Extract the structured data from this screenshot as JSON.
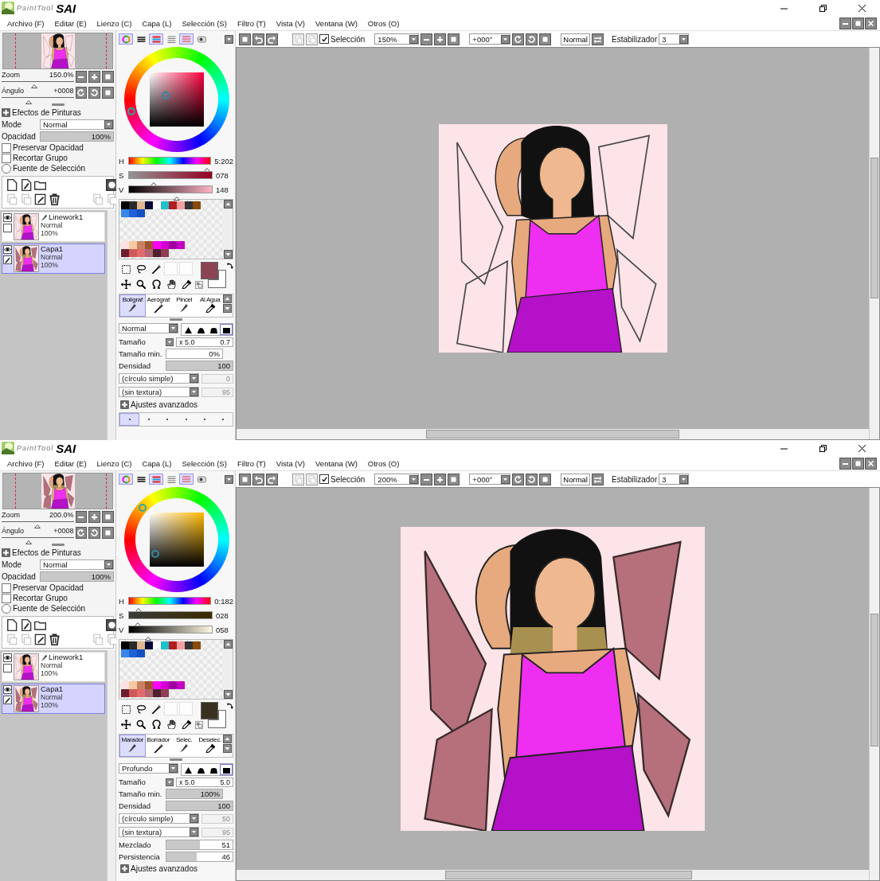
{
  "windows": [
    {
      "logo": {
        "prefix": "PaintTool",
        "name": "SAI"
      },
      "menu": [
        "Archivo (F)",
        "Editar (E)",
        "Lienzo (C)",
        "Capa (L)",
        "Selección (S)",
        "Filtro (T)",
        "Vista (V)",
        "Ventana (W)",
        "Otros (O)"
      ],
      "zoom": {
        "label": "Zoom",
        "value": "150.0%",
        "level": 0.45
      },
      "angle": {
        "label": "Ángulo",
        "value": "+0008",
        "level": 0.38
      },
      "effects": "Efectos de Pinturas",
      "mode": {
        "label": "Mode",
        "value": "Normal"
      },
      "opacity": {
        "label": "Opacidad",
        "value": "100%",
        "level": 1
      },
      "options": [
        {
          "kind": "checkbox",
          "label": "Preservar Opacidad",
          "checked": false
        },
        {
          "kind": "checkbox",
          "label": "Recortar Grupo",
          "checked": false
        },
        {
          "kind": "radio",
          "label": "Fuente de Selección",
          "checked": false
        }
      ],
      "layers": [
        {
          "name": "Linework1",
          "mode": "Normal",
          "opacity": "100%",
          "selected": false
        },
        {
          "name": "Capa1",
          "mode": "Normal",
          "opacity": "100%",
          "selected": true
        }
      ],
      "color_tabs": [
        {
          "selected": true
        },
        {
          "selected": false
        },
        {
          "selected": true
        },
        {
          "selected": false
        },
        {
          "selected": true
        },
        {
          "selected": false
        }
      ],
      "hsv": [
        {
          "label": "H",
          "value": "5:202",
          "level": 0.96
        },
        {
          "label": "S",
          "value": "078",
          "level": 0.3
        },
        {
          "label": "V",
          "value": "148",
          "level": 0.58
        }
      ],
      "palette_upper": [
        [
          {
            "color": "#000000"
          },
          {
            "color": "#2a2a2a"
          },
          {
            "color": "#e2b690"
          },
          {
            "color": "#080838"
          },
          {
            "color": "#ffffff"
          },
          {
            "color": "#1fc0cc"
          },
          {
            "color": "#b01e1e"
          },
          {
            "color": "#f5a0a0"
          },
          {
            "color": "#333333"
          },
          {
            "color": "#8a4a0a"
          }
        ],
        [
          {
            "color": "#3a86e6"
          },
          {
            "color": "#2060d8"
          },
          {
            "color": "#1450c0"
          }
        ]
      ],
      "palette_lower": [
        [
          {
            "color": "#fde2e2"
          },
          {
            "color": "#f8c8a0"
          },
          {
            "color": "#c88262"
          },
          {
            "color": "#a05232"
          },
          {
            "color": "#ff00ff"
          },
          {
            "color": "#d400d4"
          },
          {
            "color": "#a000a0"
          },
          {
            "color": "#c400c4"
          }
        ],
        [
          {
            "color": "#6e1e2a"
          },
          {
            "color": "#d05a5a"
          },
          {
            "color": "#e06c6c"
          },
          {
            "color": "#b46470"
          },
          {
            "color": "#4e2030"
          },
          {
            "color": "#8e4050"
          }
        ]
      ],
      "current_color": {
        "color": "#8b4452"
      },
      "brushes": [
        {
          "label": "Bolígraf",
          "selected": true
        },
        {
          "label": "Aerógraf",
          "selected": false
        },
        {
          "label": "Pincel",
          "selected": false
        },
        {
          "label": "Al Agua",
          "selected": false
        }
      ],
      "blend": "Normal",
      "tip_shapes": [
        {
          "selected": false
        },
        {
          "selected": false
        },
        {
          "selected": false
        },
        {
          "selected": true
        }
      ],
      "size": {
        "label": "Tamaño",
        "multiplier": "x 5.0",
        "value": "0.7"
      },
      "min_size": {
        "label": "Tamaño min.",
        "value": "0%",
        "level": 0
      },
      "density": {
        "label": "Densidad",
        "value": "100",
        "level": 1
      },
      "shape": {
        "value": "(círculo simple)",
        "field": "0",
        "disabled": true
      },
      "texture": {
        "value": "(sin textura)",
        "field": "95",
        "disabled": true
      },
      "advanced": "Ajustes avanzados",
      "brush_dots": [
        {
          "selected": true
        },
        {
          "selected": false
        },
        {
          "selected": false
        },
        {
          "selected": false
        },
        {
          "selected": false
        },
        {
          "selected": false
        }
      ],
      "toolbar": {
        "selection": {
          "label": "Selección",
          "checked": true
        },
        "zoom": "150%",
        "angle": "+000°",
        "mode": "Normal",
        "stabilizer": {
          "label": "Estabilizador",
          "value": "3"
        }
      },
      "canvas": {
        "kind": "picture"
      }
    },
    {
      "logo": {
        "prefix": "PaintTool",
        "name": "SAI"
      },
      "menu": [
        "Archivo (F)",
        "Editar (E)",
        "Lienzo (C)",
        "Capa (L)",
        "Selección (S)",
        "Filtro (T)",
        "Vista (V)",
        "Ventana (W)",
        "Otros (O)"
      ],
      "zoom": {
        "label": "Zoom",
        "value": "200.0%",
        "level": 0.5
      },
      "angle": {
        "label": "Ángulo",
        "value": "+0008",
        "level": 0.38
      },
      "effects": "Efectos de Pinturas",
      "mode": {
        "label": "Mode",
        "value": "Normal"
      },
      "opacity": {
        "label": "Opacidad",
        "value": "100%",
        "level": 1
      },
      "options": [
        {
          "kind": "checkbox",
          "label": "Preservar Opacidad",
          "checked": false
        },
        {
          "kind": "checkbox",
          "label": "Recortar Grupo",
          "checked": false
        },
        {
          "kind": "radio",
          "label": "Fuente de Selección",
          "checked": false
        }
      ],
      "layers": [
        {
          "name": "Linework1",
          "mode": "Normal",
          "opacity": "100%",
          "selected": false
        },
        {
          "name": "Capa1",
          "mode": "Normal",
          "opacity": "100%",
          "selected": true
        }
      ],
      "color_tabs": [
        {
          "selected": true
        },
        {
          "selected": false
        },
        {
          "selected": true
        },
        {
          "selected": false
        },
        {
          "selected": true
        },
        {
          "selected": false
        }
      ],
      "hsv": [
        {
          "label": "H",
          "value": "0:182",
          "level": 0.12
        },
        {
          "label": "S",
          "value": "028",
          "level": 0.11
        },
        {
          "label": "V",
          "value": "058",
          "level": 0.23
        }
      ],
      "palette_upper": [
        [
          {
            "color": "#000000"
          },
          {
            "color": "#2a2a2a"
          },
          {
            "color": "#e2b690"
          },
          {
            "color": "#080838"
          },
          {
            "color": "#ffffff"
          },
          {
            "color": "#1fc0cc"
          },
          {
            "color": "#b01e1e"
          },
          {
            "color": "#f5a0a0"
          },
          {
            "color": "#333333"
          },
          {
            "color": "#8a4a0a"
          }
        ],
        [
          {
            "color": "#3a86e6"
          },
          {
            "color": "#2060d8"
          },
          {
            "color": "#1450c0"
          }
        ]
      ],
      "palette_lower": [
        [
          {
            "color": "#fde2e2"
          },
          {
            "color": "#f8c8a0"
          },
          {
            "color": "#c88262"
          },
          {
            "color": "#a05232"
          },
          {
            "color": "#ff00ff"
          },
          {
            "color": "#d400d4"
          },
          {
            "color": "#a000a0"
          },
          {
            "color": "#c400c4"
          }
        ],
        [
          {
            "color": "#6e1e2a"
          },
          {
            "color": "#d05a5a"
          },
          {
            "color": "#e06c6c"
          },
          {
            "color": "#b46470"
          },
          {
            "color": "#4e2030"
          },
          {
            "color": "#8e4050"
          }
        ]
      ],
      "current_color": {
        "color": "#3a3020"
      },
      "brushes": [
        {
          "label": "Marador",
          "selected": true
        },
        {
          "label": "Borrador",
          "selected": false
        },
        {
          "label": "Selec.",
          "selected": false
        },
        {
          "label": "Deselec.",
          "selected": false
        }
      ],
      "blend": "Profundo",
      "tip_shapes": [
        {
          "selected": false
        },
        {
          "selected": false
        },
        {
          "selected": false
        },
        {
          "selected": true
        }
      ],
      "size": {
        "label": "Tamaño",
        "multiplier": "x 5.0",
        "value": "5.0"
      },
      "min_size": {
        "label": "Tamaño min.",
        "value": "100%",
        "level": 1
      },
      "density": {
        "label": "Densidad",
        "value": "100",
        "level": 1
      },
      "shape": {
        "value": "(círculo simple)",
        "field": "50",
        "disabled": true
      },
      "texture": {
        "value": "(sin textura)",
        "field": "95",
        "disabled": true
      },
      "extra_sliders": [
        {
          "label": "Mezclado",
          "value": "51",
          "level": 0.51
        },
        {
          "label": "Persistencia",
          "value": "46",
          "level": 0.46
        }
      ],
      "advanced": "Ajustes avanzados",
      "toolbar": {
        "selection": {
          "label": "Selección",
          "checked": true
        },
        "zoom": "200%",
        "angle": "+000°",
        "mode": "Normal",
        "stabilizer": {
          "label": "Estabilizador",
          "value": "3"
        }
      },
      "canvas": {
        "kind": "picture"
      }
    }
  ]
}
